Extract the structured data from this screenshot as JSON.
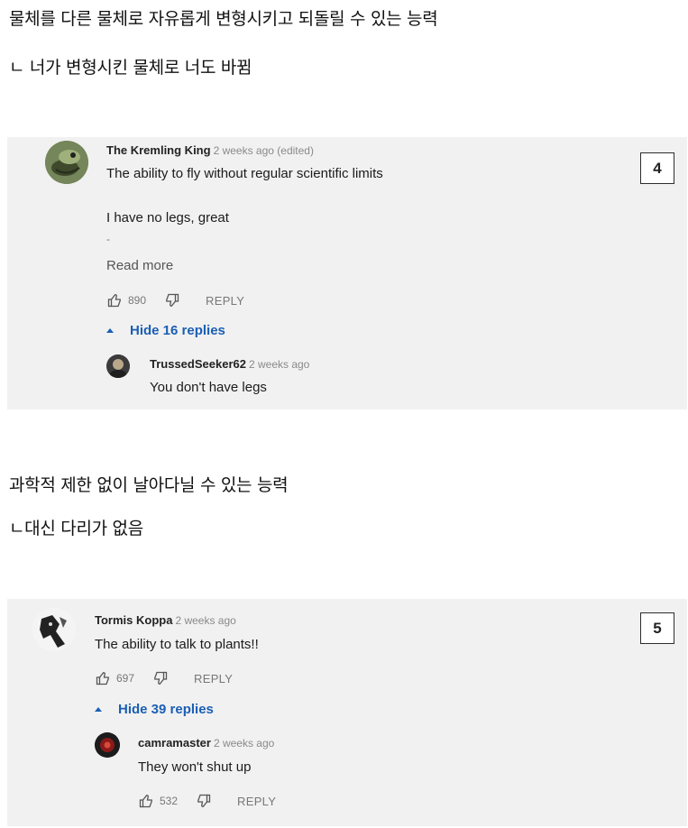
{
  "post": {
    "lines": [
      "물체를 다른 물체로 자유롭게 변형시키고 되돌릴 수 있는 능력",
      "ㄴ 너가 변형시킨 물체로 너도 바뀜",
      "과학적 제한 없이 날아다닐 수 있는 능력",
      "ㄴ대신 다리가 없음"
    ]
  },
  "threads": [
    {
      "number": "4",
      "comment": {
        "author": "The Kremling King",
        "meta": "2 weeks ago (edited)",
        "lines": [
          "The ability to fly without regular scientific limits",
          "I have no legs, great",
          "-"
        ],
        "read_more": "Read more",
        "likes": "890",
        "reply_label": "REPLY"
      },
      "hide_replies": "Hide 16 replies",
      "reply": {
        "author": "TrussedSeeker62",
        "meta": "2 weeks ago",
        "text": "You don't have legs"
      }
    },
    {
      "number": "5",
      "comment": {
        "author": "Tormis Koppa",
        "meta": "2 weeks ago",
        "lines": [
          "The ability to talk to plants!!"
        ],
        "likes": "697",
        "reply_label": "REPLY"
      },
      "hide_replies": "Hide 39 replies",
      "reply": {
        "author": "camramaster",
        "meta": "2 weeks ago",
        "text": "They won't shut up",
        "likes": "532",
        "reply_label": "REPLY"
      }
    }
  ],
  "icons": {
    "like": "thumbs-up-icon",
    "dislike": "thumbs-down-icon",
    "collapse": "triangle-up-icon"
  },
  "colors": {
    "panel_bg": "#f1f1f1",
    "link_blue": "#1a5fb4"
  }
}
